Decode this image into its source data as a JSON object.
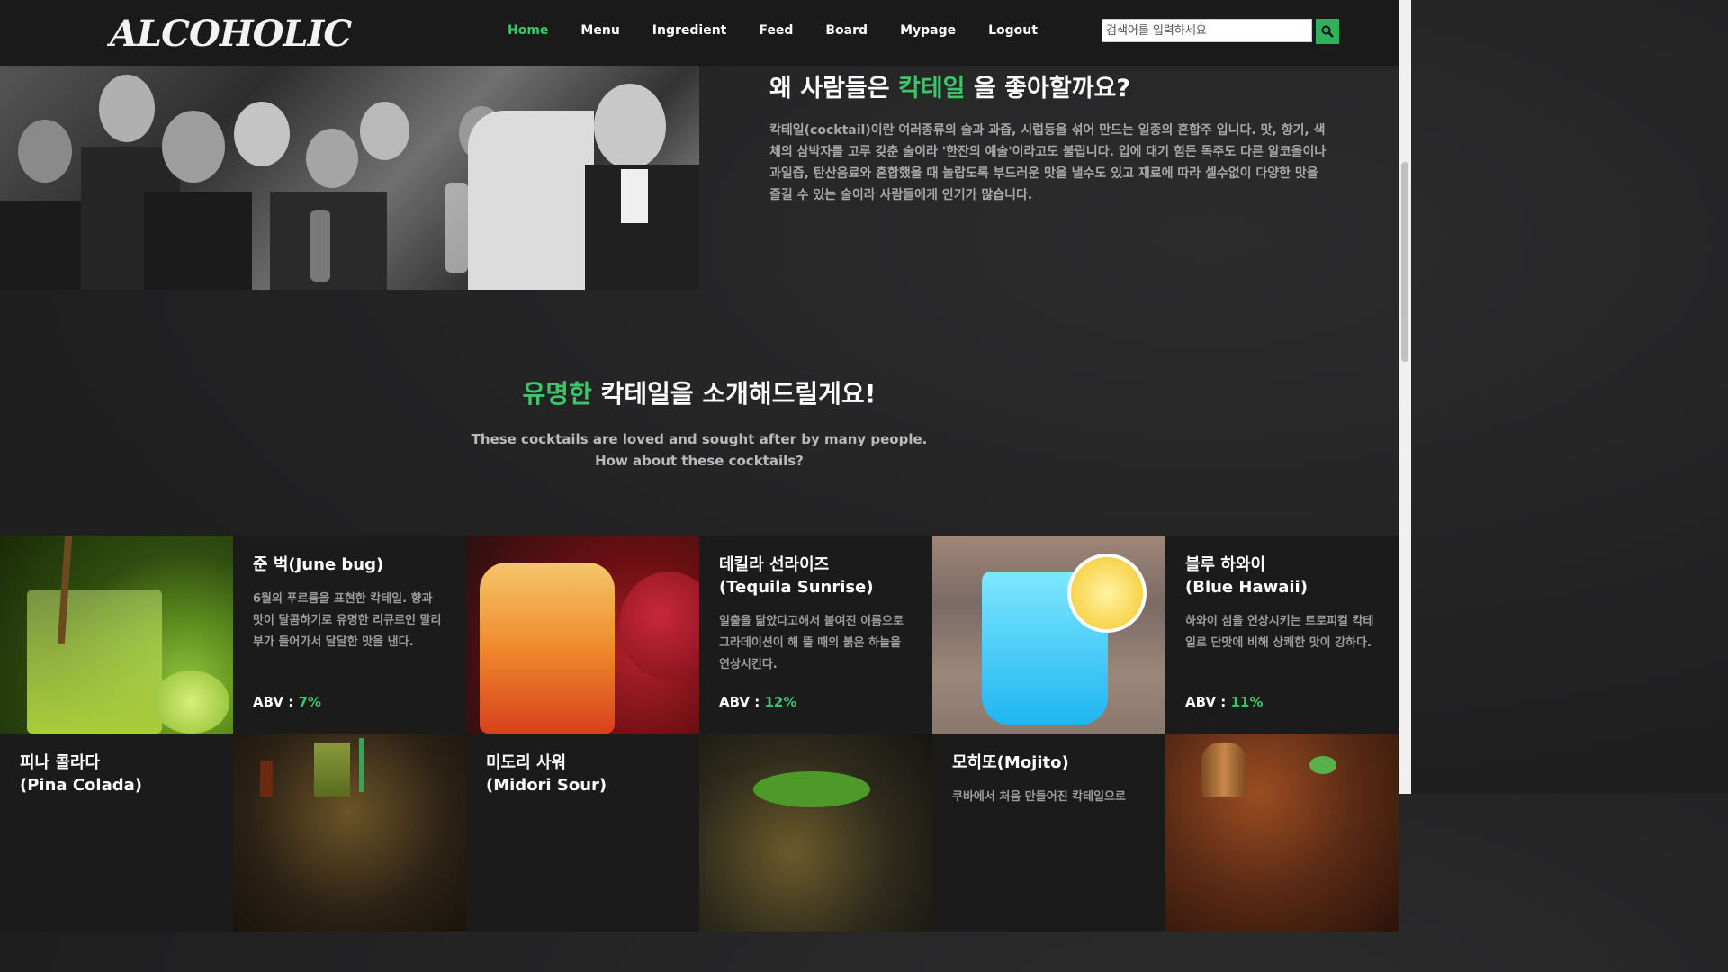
{
  "nav": {
    "logo": "ALCOHOLIC",
    "items": [
      {
        "label": "Home",
        "active": true
      },
      {
        "label": "Menu"
      },
      {
        "label": "Ingredient"
      },
      {
        "label": "Feed"
      },
      {
        "label": "Board"
      },
      {
        "label": "Mypage"
      },
      {
        "label": "Logout"
      }
    ],
    "search_placeholder": "검색어를 입력하세요"
  },
  "why": {
    "title_pre": "왜 사람들은 ",
    "title_hl": "칵테일",
    "title_post": " 을 좋아할까요?",
    "text": "칵테일(cocktail)이란 여러종류의 술과 과즙, 시럽등을 섞어 만드는 일종의 혼합주 입니다. 맛, 향기, 색체의 삼박자를 고루 갖춘 술이라 '한잔의 예술'이라고도 불립니다. 입에 대기 힘든 독주도 다른 알코올이나 과일즙, 탄산음료와 혼합했을 때 놀랍도록 부드러운 맛을 낼수도 있고 재료에 따라 셀수없이 다양한 맛을 즐길 수 있는 술이라 사람들에게 인기가 많습니다."
  },
  "famous": {
    "title_hl": "유명한",
    "title_post": " 칵테일을 소개해드릴게요!",
    "sub1": "These cocktails are loved and sought after by many people.",
    "sub2": "How about these cocktails?"
  },
  "cards": [
    {
      "title": "준 벅(June bug)",
      "desc": "6월의 푸르름을 표현한 칵테일. 향과 맛이 달콤하기로 유명한 리큐르인 말리부가 들어가서 달달한 맛을 낸다.",
      "abv_label": "ABV : ",
      "abv": "7%"
    },
    {
      "title": "데킬라 선라이즈\n(Tequila Sunrise)",
      "desc": "일출을 닮았다고해서 붙여진 이름으로 그라데이션이 해 뜰 때의 붉은 하늘을 연상시킨다.",
      "abv_label": "ABV : ",
      "abv": "12%"
    },
    {
      "title": "블루 하와이\n(Blue Hawaii)",
      "desc": "하와이 섬을 연상시키는 트로피컬 칵테일로 단맛에 비해 상쾌한 맛이 강하다.",
      "abv_label": "ABV : ",
      "abv": "11%"
    },
    {
      "title": "피나 콜라다\n(Pina Colada)"
    },
    {
      "title": "미도리 사워\n(Midori Sour)"
    },
    {
      "title": "모히또(Mojito)",
      "desc": "쿠바에서 처음 만들어진 칵테일으로"
    }
  ],
  "colors": {
    "accent": "#3cc66a",
    "nav_bg": "#1a1a1b",
    "search_btn": "#2fb05a"
  }
}
